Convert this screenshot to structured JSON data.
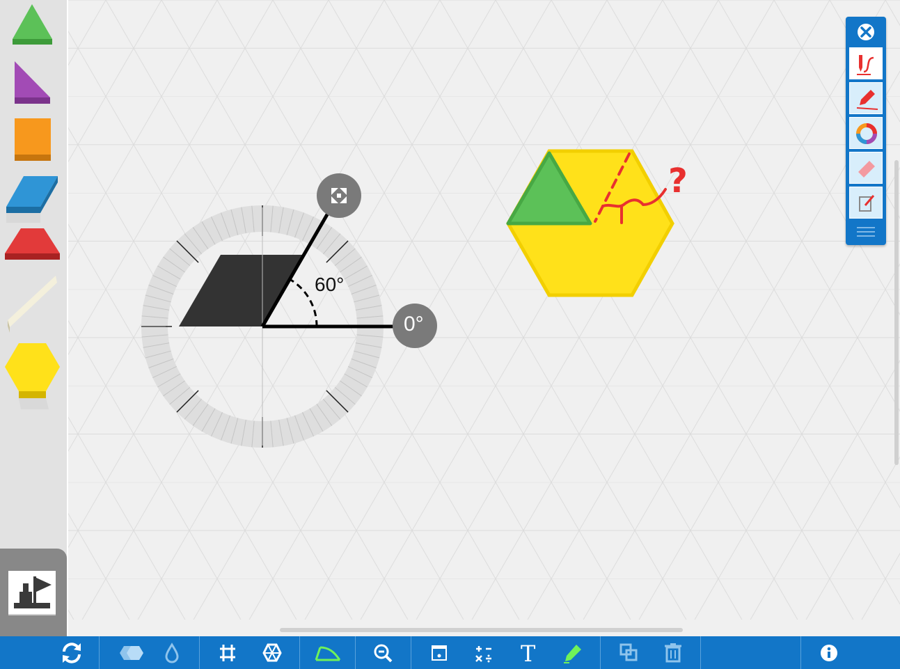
{
  "palette": {
    "shapes": [
      {
        "name": "green-triangle",
        "color": "#5cc158"
      },
      {
        "name": "purple-right-triangle",
        "color": "#a24bb5"
      },
      {
        "name": "orange-square",
        "color": "#f7981d"
      },
      {
        "name": "blue-rhombus",
        "color": "#2f95d6"
      },
      {
        "name": "red-trapezoid",
        "color": "#e23a3a"
      },
      {
        "name": "tan-thin-rhombus",
        "color": "#f4f0dc"
      },
      {
        "name": "yellow-hexagon",
        "color": "#ffe11a"
      }
    ],
    "stamp_icon": "stamp-icon"
  },
  "protractor": {
    "angle_label": "60°",
    "zero_label": "0°",
    "handle_icon": "move-arrows-icon"
  },
  "workspace": {
    "hexagon_color": "#ffe11a",
    "triangle_color": "#5cc158",
    "annotation_color": "#e8302f",
    "annotation_text": "?"
  },
  "draw_toolbar": {
    "close_icon": "close-icon",
    "tools": [
      {
        "name": "pen-stroke-tool",
        "icon": "pen-stroke-icon"
      },
      {
        "name": "marker-tool",
        "icon": "marker-icon"
      },
      {
        "name": "color-picker-tool",
        "icon": "color-wheel-icon"
      },
      {
        "name": "eraser-tool",
        "icon": "eraser-icon"
      },
      {
        "name": "clear-drawing-tool",
        "icon": "edit-note-icon"
      }
    ],
    "menu_icon": "hamburger-menu-icon"
  },
  "bottom_toolbar": {
    "buttons": [
      "refresh-icon",
      "shapes-icon",
      "fill-drop-icon",
      "grid-icon",
      "hex-grid-icon",
      "protractor-icon",
      "zoom-out-icon",
      "screen-icon",
      "operations-icon",
      "text-icon",
      "highlighter-icon",
      "duplicate-icon",
      "trash-icon",
      "info-icon"
    ],
    "text_button_label": "T"
  },
  "colors": {
    "toolbar_blue": "#1276c8",
    "canvas_bg": "#f0f0f0",
    "protractor_body": "#333333",
    "highlighter_green": "#6ff25a"
  }
}
